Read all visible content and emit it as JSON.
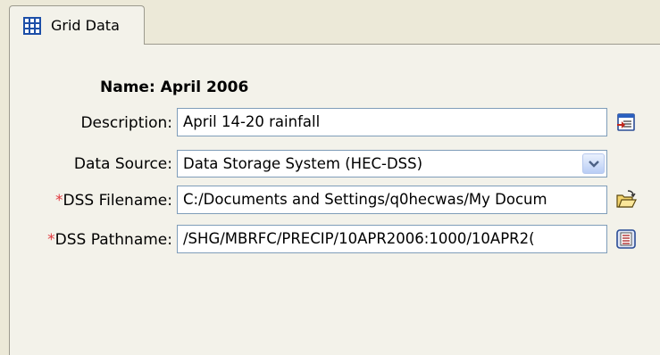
{
  "tab": {
    "label": "Grid Data",
    "icon": "grid-icon"
  },
  "form": {
    "name_label": "Name:",
    "name_value": "April 2006",
    "description_label": "Description:",
    "description_value": "April 14-20 rainfall",
    "data_source_label": "Data Source:",
    "data_source_value": "Data Storage System (HEC-DSS)",
    "dss_filename_required": "*",
    "dss_filename_label": "DSS Filename:",
    "dss_filename_value": "C:/Documents and Settings/q0hecwas/My Docum",
    "dss_pathname_required": "*",
    "dss_pathname_label": "DSS Pathname:",
    "dss_pathname_value": "/SHG/MBRFC/PRECIP/10APR2006:1000/10APR2("
  },
  "icons": {
    "description_button": "edit-description-icon",
    "open_file": "open-folder-icon",
    "pathname_select": "list-select-icon",
    "dropdown": "chevron-down-icon"
  },
  "colors": {
    "background": "#ece9d8",
    "panel": "#f3f2ea",
    "field_border": "#7f9db9",
    "required": "#e0383e"
  }
}
